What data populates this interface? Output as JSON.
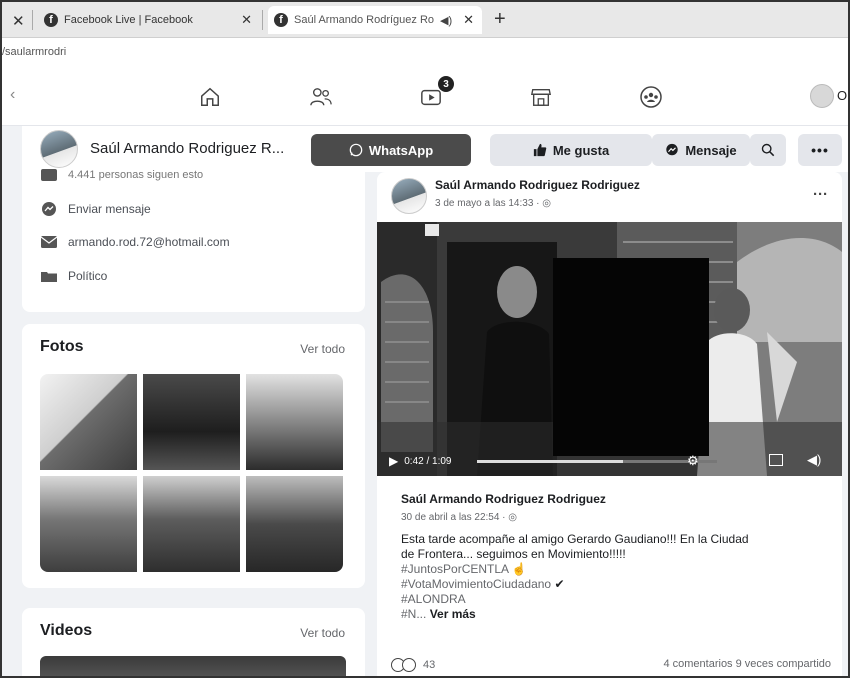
{
  "browser": {
    "tabs": [
      {
        "title": "Facebook Live | Facebook",
        "active": false
      },
      {
        "title": "Saúl Armando Rodríguez Ro",
        "active": true
      }
    ],
    "url": "/saularmrodri"
  },
  "nav": {
    "watch_badge": "3",
    "user_name_partial": "Ol"
  },
  "profile": {
    "name": "Saúl Armando Rodriguez R...",
    "buttons": {
      "whatsapp": "WhatsApp",
      "like": "Me gusta",
      "message": "Mensaje"
    }
  },
  "intro": {
    "followers": "4.441 personas siguen esto",
    "send_message": "Enviar mensaje",
    "email": "armando.rod.72@hotmail.com",
    "category": "Político"
  },
  "photos": {
    "title": "Fotos",
    "link": "Ver todo"
  },
  "videos": {
    "title": "Videos",
    "link": "Ver todo"
  },
  "post": {
    "author": "Saúl Armando Rodriguez Rodriguez",
    "time": "3 de mayo a las 14:33 · ",
    "video": {
      "time": "0:42 / 1:09",
      "progress": 0.61
    },
    "shared": {
      "author": "Saúl Armando Rodriguez Rodriguez",
      "time": "30 de abril a las 22:54 · ",
      "text_line1": "Esta tarde acompañe al amigo Gerardo Gaudiano!!! En la Ciudad",
      "text_line2": "de Frontera... seguimos en Movimiento!!!!!",
      "tag1": "#JuntosPorCENTLA",
      "tag2": "#VotaMovimientoCiudadano",
      "tag3": "#ALONDRA",
      "tag4": "#N...",
      "more": "Ver más"
    },
    "reactions": "43",
    "comments_shares": "4 comentarios  9 veces compartido"
  },
  "colors": {
    "facebook_bg": "#f0f2f5",
    "whatsapp_button": "#4b4b4b",
    "secondary_button": "#e4e6eb"
  }
}
